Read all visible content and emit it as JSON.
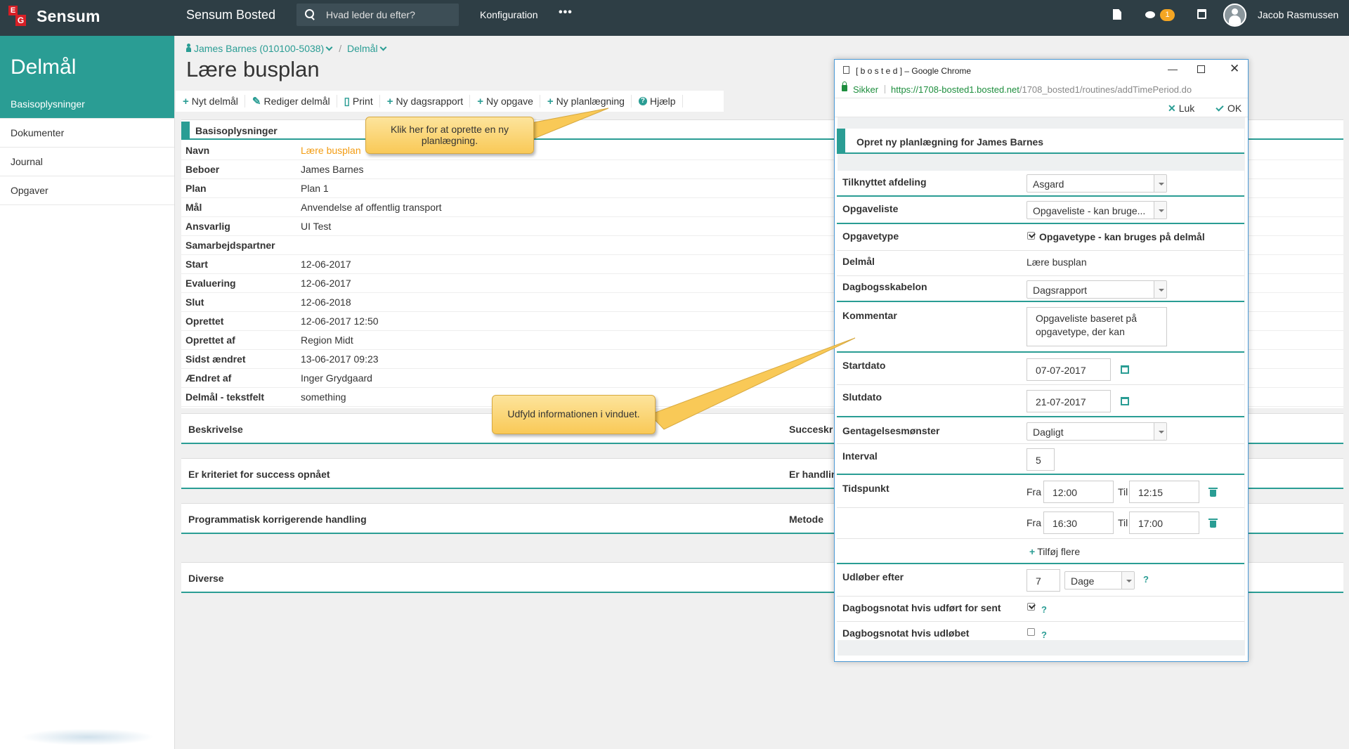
{
  "topbar": {
    "logo_text": "Sensum",
    "logo_letters": [
      "E",
      "G"
    ],
    "app_title": "Sensum Bosted",
    "search_placeholder": "Hvad leder du efter?",
    "config_label": "Konfiguration",
    "more_label": "•••",
    "chat_badge": "1",
    "username": "Jacob Rasmussen",
    "icons": [
      "search-icon",
      "document-icon",
      "chat-icon",
      "calendar-icon",
      "avatar"
    ]
  },
  "sidebar": {
    "title": "Delmål",
    "items": [
      {
        "label": "Basisoplysninger",
        "active": true
      },
      {
        "label": "Dokumenter",
        "active": false
      },
      {
        "label": "Journal",
        "active": false
      },
      {
        "label": "Opgaver",
        "active": false
      }
    ]
  },
  "breadcrumb": {
    "person": "James Barnes (010100-5038)",
    "sep": "/",
    "section": "Delmål"
  },
  "page_title": "Lære busplan",
  "toolbar": [
    {
      "icon": "+",
      "label": "Nyt delmål"
    },
    {
      "icon": "✎",
      "label": "Rediger delmål"
    },
    {
      "icon": "▯",
      "label": "Print"
    },
    {
      "icon": "+",
      "label": "Ny dagsrapport"
    },
    {
      "icon": "+",
      "label": "Ny opgave"
    },
    {
      "icon": "+",
      "label": "Ny planlægning"
    },
    {
      "icon": "?",
      "label": "Hjælp"
    }
  ],
  "info": {
    "header": "Basisoplysninger",
    "rows": [
      {
        "key": "Navn",
        "value": "Lære busplan"
      },
      {
        "key": "Beboer",
        "value": "James Barnes"
      },
      {
        "key": "Plan",
        "value": "Plan 1"
      },
      {
        "key": "Mål",
        "value": "Anvendelse af offentlig transport"
      },
      {
        "key": "Ansvarlig",
        "value": "UI Test"
      },
      {
        "key": "Samarbejdspartner",
        "value": ""
      },
      {
        "key": "Start",
        "value": "12-06-2017"
      },
      {
        "key": "Evaluering",
        "value": "12-06-2017"
      },
      {
        "key": "Slut",
        "value": "12-06-2018"
      },
      {
        "key": "Oprettet",
        "value": "12-06-2017 12:50"
      },
      {
        "key": "Oprettet af",
        "value": "Region Midt"
      },
      {
        "key": "Sidst ændret",
        "value": "13-06-2017 09:23"
      },
      {
        "key": "Ændret af",
        "value": "Inger Grydgaard"
      },
      {
        "key": "Delmål - tekstfelt",
        "value": "something"
      }
    ]
  },
  "sections": {
    "beskrivelse": "Beskrivelse",
    "succes": "Succeskr",
    "kriteriet": "Er kriteriet for success opnået",
    "handling": "Er handlin",
    "programmatisk": "Programmatisk korrigerende handling",
    "metode": "Metode",
    "diverse": "Diverse"
  },
  "callouts": {
    "top": "Klik her for at oprette en ny planlægning.",
    "bottom": "Udfyld informationen i vinduet."
  },
  "popup": {
    "window_title": "[ b o s t e d ] – Google Chrome",
    "secure_label": "Sikker",
    "url_host": "https://1708-bosted1.bosted.net",
    "url_path": "/1708_bosted1/routines/addTimePeriod.do",
    "close_label": "Luk",
    "ok_label": "OK",
    "form_title": "Opret ny planlægning for James Barnes",
    "fields": {
      "afdeling_label": "Tilknyttet afdeling",
      "afdeling_value": "Asgard",
      "opgaveliste_label": "Opgaveliste",
      "opgaveliste_value": "Opgaveliste - kan bruge...",
      "opgavetype_label": "Opgavetype",
      "opgavetype_value": "Opgavetype - kan bruges på delmål",
      "opgavetype_checked": true,
      "delmaal_label": "Delmål",
      "delmaal_value": "Lære busplan",
      "skabelon_label": "Dagbogsskabelon",
      "skabelon_value": "Dagsrapport",
      "kommentar_label": "Kommentar",
      "kommentar_value": "Opgaveliste baseret på opgavetype, der kan",
      "startdato_label": "Startdato",
      "startdato_value": "07-07-2017",
      "slutdato_label": "Slutdato",
      "slutdato_value": "21-07-2017",
      "moenster_label": "Gentagelsesmønster",
      "moenster_value": "Dagligt",
      "interval_label": "Interval",
      "interval_value": "5",
      "tidspunkt_label": "Tidspunkt",
      "fra_label": "Fra",
      "til_label": "Til",
      "times": [
        {
          "from": "12:00",
          "to": "12:15"
        },
        {
          "from": "16:30",
          "to": "17:00"
        }
      ],
      "add_more_label": "Tilføj flere",
      "udloeber_label": "Udløber efter",
      "udloeber_value": "7",
      "udloeber_unit": "Dage",
      "sent_label": "Dagbogsnotat hvis udført for sent",
      "sent_checked": true,
      "udloebet_label": "Dagbogsnotat hvis udløbet",
      "udloebet_checked": false,
      "help": "?"
    }
  },
  "colors": {
    "topbar": "#2e3e45",
    "accent": "#2a9d94",
    "brand_red": "#d71f26",
    "callout": "#f9c957",
    "badge": "#f5a623"
  }
}
